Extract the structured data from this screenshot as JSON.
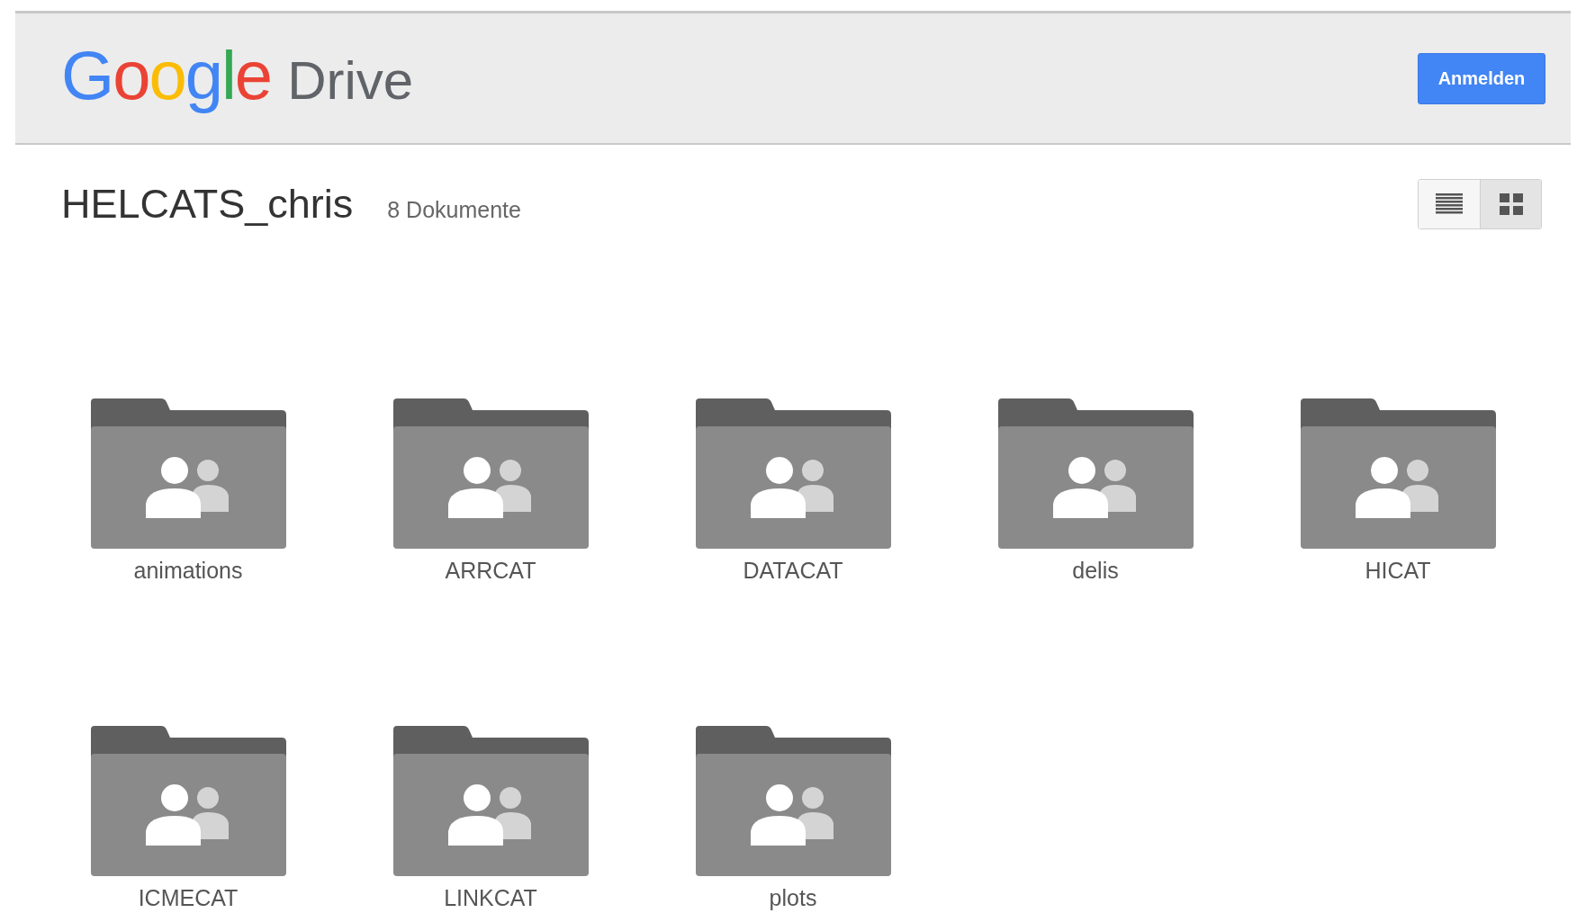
{
  "header": {
    "logo": {
      "brand": "Google",
      "product": "Drive"
    },
    "sign_in_button": "Anmelden"
  },
  "folder": {
    "title": "HELCATS_chris",
    "count": "8 Dokumente"
  },
  "view_toggle": [
    {
      "kind": "list",
      "selected": false
    },
    {
      "kind": "grid",
      "selected": true
    }
  ],
  "items": [
    {
      "name": "animations",
      "kind": "shared-folder"
    },
    {
      "name": "ARRCAT",
      "kind": "shared-folder"
    },
    {
      "name": "DATACAT",
      "kind": "shared-folder"
    },
    {
      "name": "delis",
      "kind": "shared-folder"
    },
    {
      "name": "HICAT",
      "kind": "shared-folder"
    },
    {
      "name": "ICMECAT",
      "kind": "shared-folder"
    },
    {
      "name": "LINKCAT",
      "kind": "shared-folder"
    },
    {
      "name": "plots",
      "kind": "shared-folder"
    }
  ]
}
